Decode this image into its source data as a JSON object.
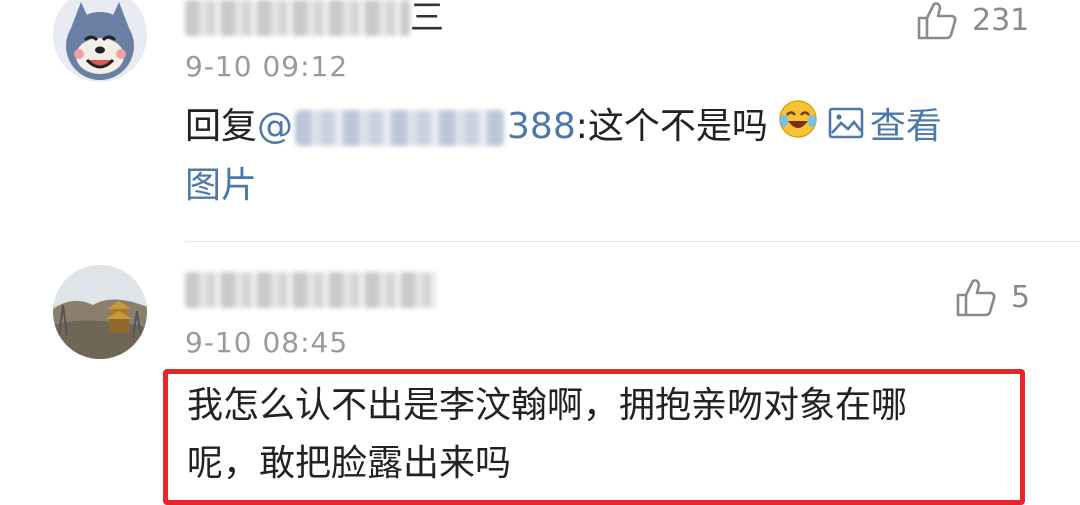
{
  "comments": [
    {
      "name_visible_suffix": "三",
      "time": "9-10 09:12",
      "likes": "231",
      "reply_prefix": "回复",
      "mention_at": "@",
      "mention_visible_suffix": "388",
      "text": ":这个不是吗",
      "view_image_line1": "查看",
      "view_image_line2": "图片"
    },
    {
      "time": "9-10 08:45",
      "likes": "5",
      "text_line1": "我怎么认不出是李汶翰啊，拥抱亲吻对象在哪",
      "text_line2": "呢，敢把脸露出来吗"
    }
  ],
  "icons": {
    "like": "thumbs-up-icon",
    "emoji": "laughing-tears-emoji-icon",
    "image": "image-icon"
  },
  "colors": {
    "link": "#4d79a8",
    "highlight_border": "#e8262a",
    "time": "#9a9a9a"
  }
}
